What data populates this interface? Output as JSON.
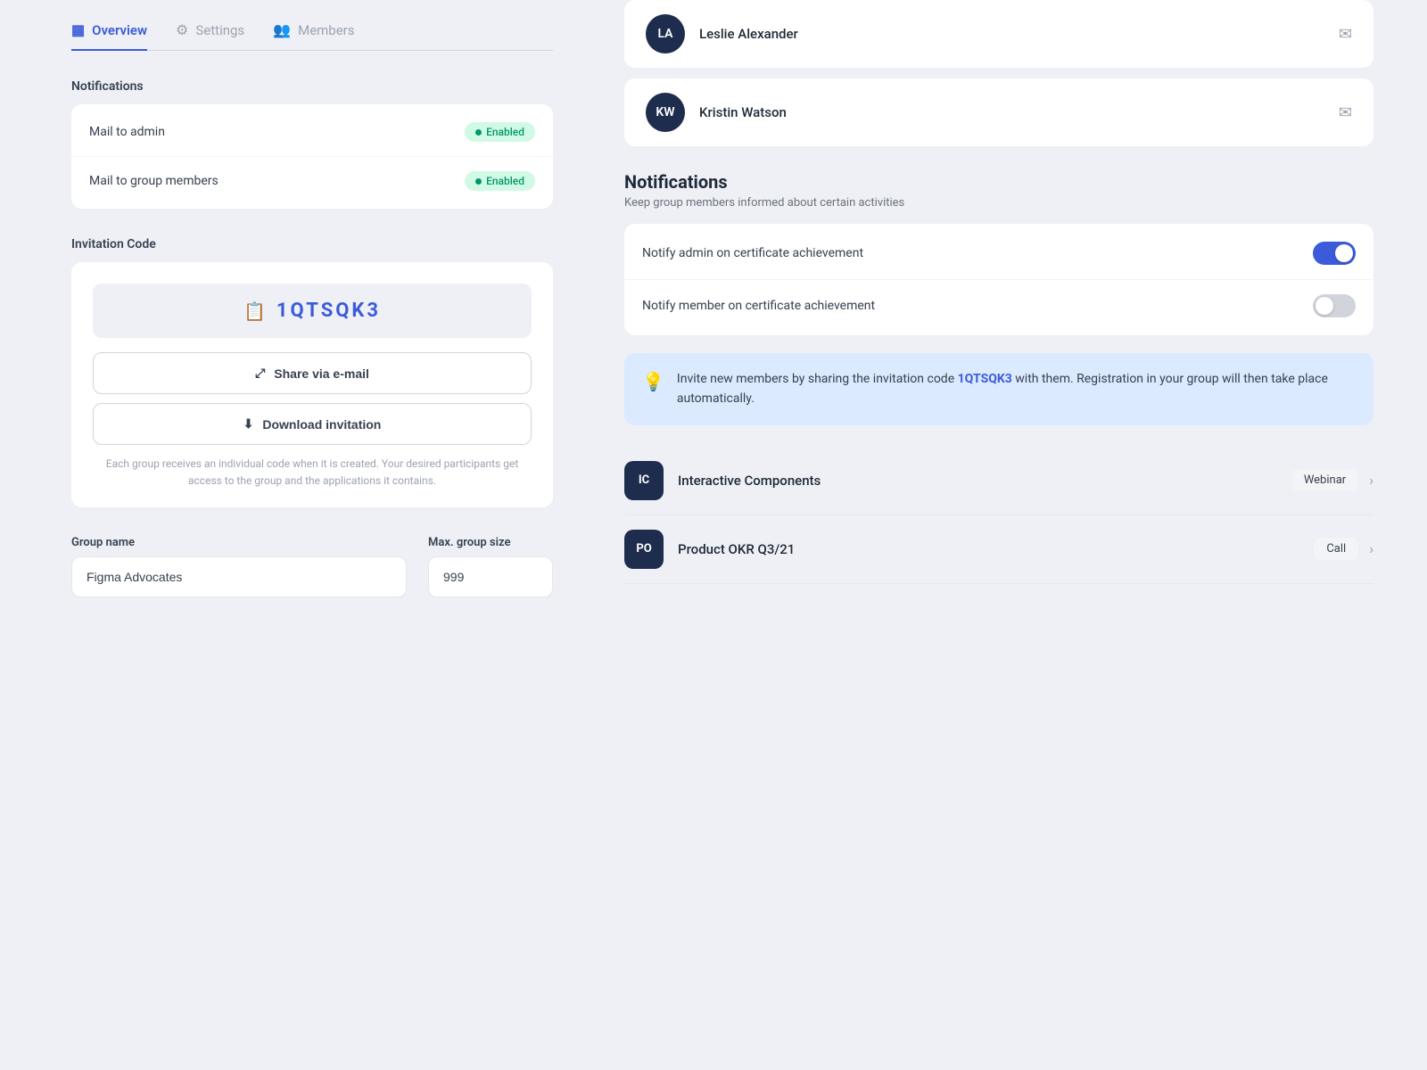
{
  "tabs": [
    {
      "id": "overview",
      "label": "Overview",
      "icon": "⊞",
      "active": true
    },
    {
      "id": "settings",
      "label": "Settings",
      "icon": "⚙",
      "active": false
    },
    {
      "id": "members",
      "label": "Members",
      "icon": "👥",
      "active": false
    }
  ],
  "left": {
    "notifications_label": "Notifications",
    "notification_rows": [
      {
        "label": "Mail to admin",
        "status": "Enabled"
      },
      {
        "label": "Mail to group members",
        "status": "Enabled"
      }
    ],
    "invitation_code_label": "Invitation Code",
    "code": "1QTSQK3",
    "share_btn": "Share via e-mail",
    "download_btn": "Download invitation",
    "invitation_note": "Each group receives an individual code when it is created. Your desired participants get access to the group and the applications it contains.",
    "group_name_label": "Group name",
    "group_name_value": "Figma Advocates",
    "max_group_size_label": "Max. group size",
    "max_group_size_value": "999"
  },
  "right": {
    "members": [
      {
        "initials": "LA",
        "name": "Leslie Alexander"
      },
      {
        "initials": "KW",
        "name": "Kristin Watson"
      }
    ],
    "notifications_title": "Notifications",
    "notifications_sub": "Keep group members informed about certain activities",
    "toggle_rows": [
      {
        "label": "Notify admin on certificate achievement",
        "on": true
      },
      {
        "label": "Notify member on certificate achievement",
        "on": false
      }
    ],
    "info_text_plain": "Invite new members by sharing the invitation code ",
    "info_code": "1QTSQK3",
    "info_text_end": " with them. Registration in your group will then take place automatically.",
    "courses": [
      {
        "initials": "IC",
        "name": "Interactive Components",
        "tag": "Webinar"
      },
      {
        "initials": "PO",
        "name": "Product OKR Q3/21",
        "tag": "Call"
      }
    ]
  }
}
